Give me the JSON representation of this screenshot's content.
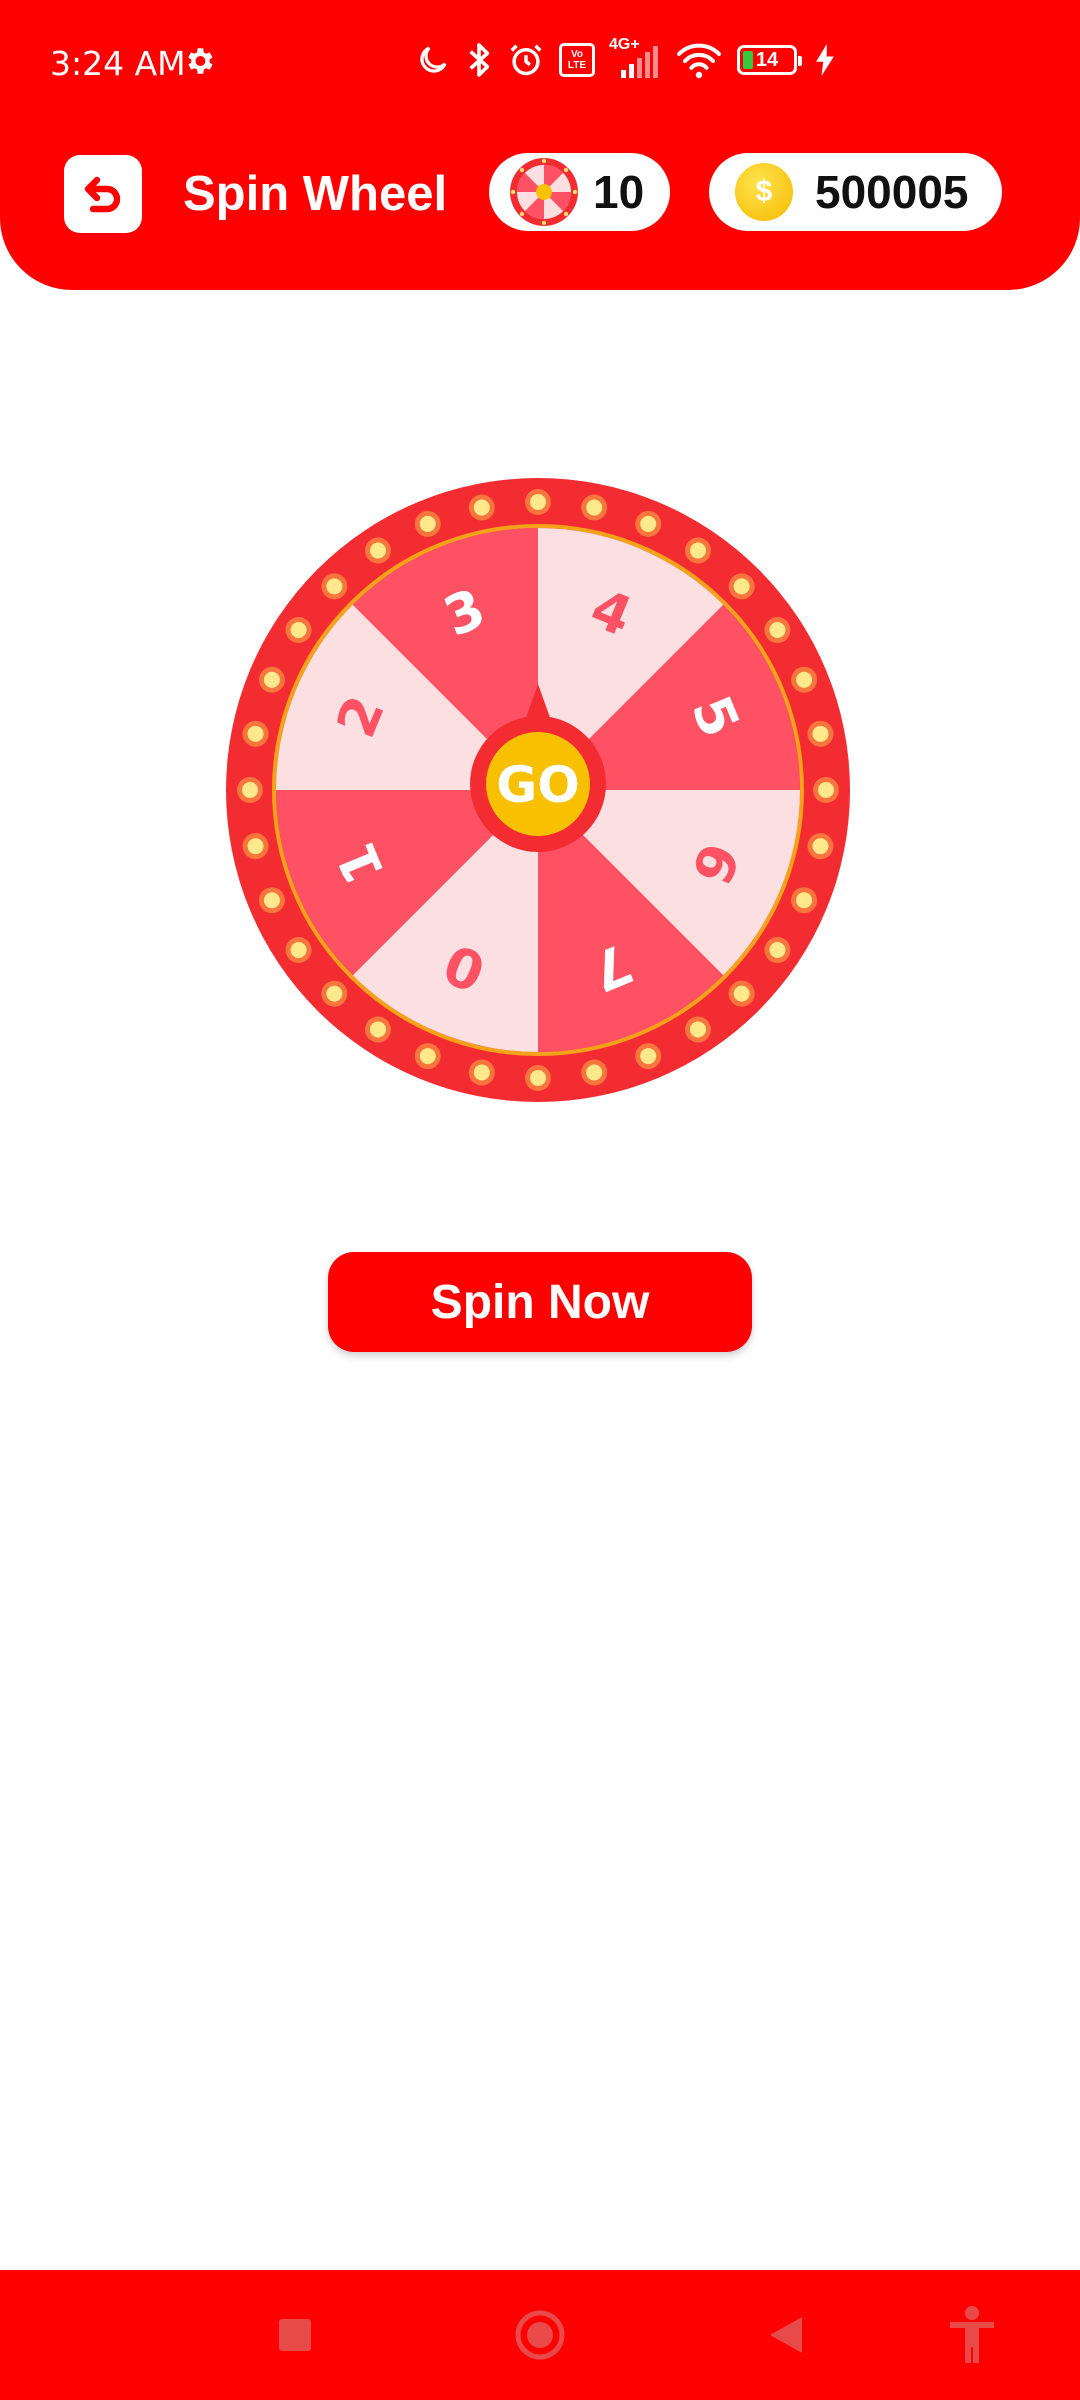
{
  "status_bar": {
    "time": "3:24 AM",
    "volte_top": "Vo",
    "volte_bottom": "LTE",
    "network": "4G+",
    "battery": "14"
  },
  "header": {
    "title": "Spin Wheel",
    "spins_count": "10",
    "coins": "500005"
  },
  "wheel": {
    "segments": [
      "0",
      "7",
      "6",
      "5",
      "4",
      "3",
      "2",
      "1"
    ],
    "center_label": "GO"
  },
  "spin_button": {
    "label": "Spin Now"
  },
  "colors": {
    "brand_red": "#fe0000",
    "segment_dark": "#fe5264",
    "segment_light": "#fcdfe0",
    "rim_red": "#f32c31",
    "gold": "#f7c000"
  }
}
